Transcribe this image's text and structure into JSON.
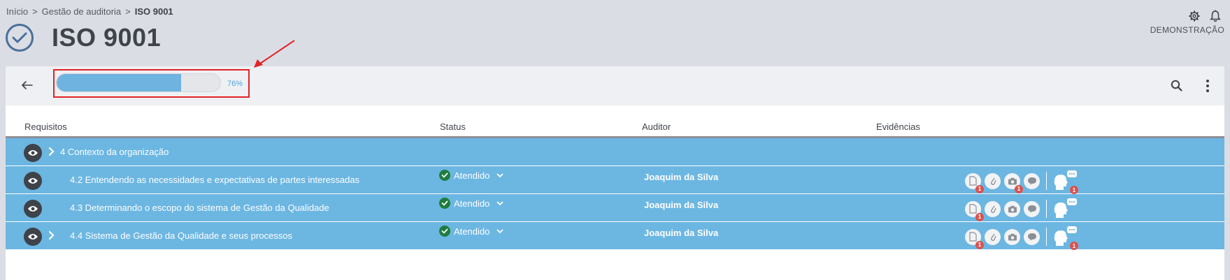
{
  "breadcrumb": {
    "items": [
      "Início",
      "Gestão de auditoria"
    ],
    "separator": ">",
    "current": "ISO 9001"
  },
  "page": {
    "title": "ISO 9001"
  },
  "user": {
    "label": "DEMONSTRAÇÃO"
  },
  "toolbar": {
    "progress_percent": 76,
    "progress_text": "76%"
  },
  "columns": {
    "requirements": "Requisitos",
    "status": "Status",
    "auditor": "Auditor",
    "evidence": "Evidências"
  },
  "rows": [
    {
      "label": "4 Contexto da organização",
      "type": "group"
    },
    {
      "label": "4.2 Entendendo as necessidades e expectativas de partes interessadas",
      "status": "Atendido",
      "auditor": "Joaquim da Silva",
      "badges": {
        "documents": "1",
        "photos": "1",
        "comments": "1"
      }
    },
    {
      "label": "4.3 Determinando o escopo do sistema de Gestão da Qualidade",
      "status": "Atendido",
      "auditor": "Joaquim da Silva",
      "badges": {
        "documents": "1",
        "photos": "",
        "comments": ""
      }
    },
    {
      "label": "4.4 Sistema de Gestão da Qualidade e seus processos",
      "status": "Atendido",
      "auditor": "Joaquim da Silva",
      "badges": {
        "documents": "1",
        "photos": "",
        "comments": "1"
      }
    }
  ],
  "colors": {
    "row_bg": "#6cb6e2",
    "progress_fill": "#6fb3e0",
    "status_ok": "#1e7d3e",
    "highlight": "#e32227",
    "badge": "#d9534f"
  }
}
